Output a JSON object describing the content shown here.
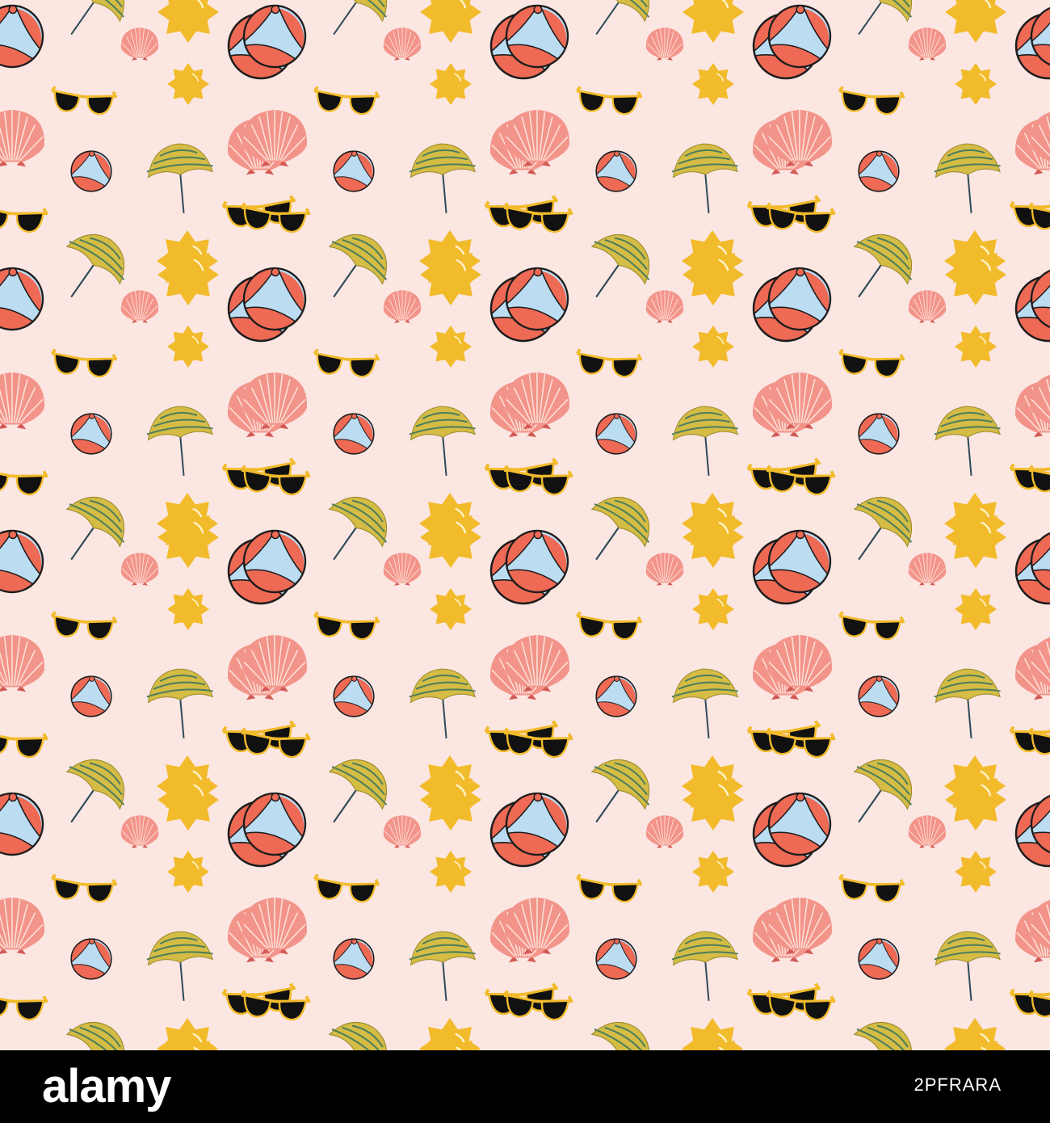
{
  "pattern": {
    "motifs": [
      "beach-ball-icon",
      "sun-icon",
      "seashell-icon",
      "sunglasses-icon",
      "beach-umbrella-icon"
    ],
    "colors": {
      "background": "#fbe6e2",
      "sun": "#f2bb2b",
      "shell": "#f3948a",
      "ball_red": "#ee6a55",
      "ball_blue": "#bcdcf2",
      "umbrella": "#d4bc45",
      "umbrella_stripe": "#4b7d5c",
      "glasses_frame": "#f2bb2b",
      "glasses_lens": "#111111"
    }
  },
  "footer": {
    "logo": "alamy",
    "image_id": "2PFRARA"
  }
}
